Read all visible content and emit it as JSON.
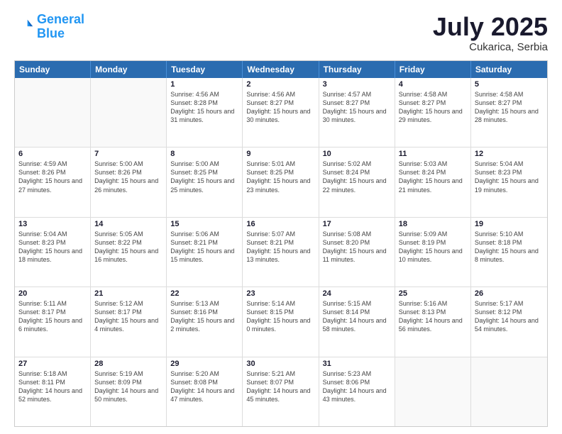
{
  "logo": {
    "line1": "General",
    "line2": "Blue"
  },
  "title": "July 2025",
  "subtitle": "Cukarica, Serbia",
  "header_days": [
    "Sunday",
    "Monday",
    "Tuesday",
    "Wednesday",
    "Thursday",
    "Friday",
    "Saturday"
  ],
  "weeks": [
    [
      {
        "day": "",
        "sunrise": "",
        "sunset": "",
        "daylight": ""
      },
      {
        "day": "",
        "sunrise": "",
        "sunset": "",
        "daylight": ""
      },
      {
        "day": "1",
        "sunrise": "Sunrise: 4:56 AM",
        "sunset": "Sunset: 8:28 PM",
        "daylight": "Daylight: 15 hours and 31 minutes."
      },
      {
        "day": "2",
        "sunrise": "Sunrise: 4:56 AM",
        "sunset": "Sunset: 8:27 PM",
        "daylight": "Daylight: 15 hours and 30 minutes."
      },
      {
        "day": "3",
        "sunrise": "Sunrise: 4:57 AM",
        "sunset": "Sunset: 8:27 PM",
        "daylight": "Daylight: 15 hours and 30 minutes."
      },
      {
        "day": "4",
        "sunrise": "Sunrise: 4:58 AM",
        "sunset": "Sunset: 8:27 PM",
        "daylight": "Daylight: 15 hours and 29 minutes."
      },
      {
        "day": "5",
        "sunrise": "Sunrise: 4:58 AM",
        "sunset": "Sunset: 8:27 PM",
        "daylight": "Daylight: 15 hours and 28 minutes."
      }
    ],
    [
      {
        "day": "6",
        "sunrise": "Sunrise: 4:59 AM",
        "sunset": "Sunset: 8:26 PM",
        "daylight": "Daylight: 15 hours and 27 minutes."
      },
      {
        "day": "7",
        "sunrise": "Sunrise: 5:00 AM",
        "sunset": "Sunset: 8:26 PM",
        "daylight": "Daylight: 15 hours and 26 minutes."
      },
      {
        "day": "8",
        "sunrise": "Sunrise: 5:00 AM",
        "sunset": "Sunset: 8:25 PM",
        "daylight": "Daylight: 15 hours and 25 minutes."
      },
      {
        "day": "9",
        "sunrise": "Sunrise: 5:01 AM",
        "sunset": "Sunset: 8:25 PM",
        "daylight": "Daylight: 15 hours and 23 minutes."
      },
      {
        "day": "10",
        "sunrise": "Sunrise: 5:02 AM",
        "sunset": "Sunset: 8:24 PM",
        "daylight": "Daylight: 15 hours and 22 minutes."
      },
      {
        "day": "11",
        "sunrise": "Sunrise: 5:03 AM",
        "sunset": "Sunset: 8:24 PM",
        "daylight": "Daylight: 15 hours and 21 minutes."
      },
      {
        "day": "12",
        "sunrise": "Sunrise: 5:04 AM",
        "sunset": "Sunset: 8:23 PM",
        "daylight": "Daylight: 15 hours and 19 minutes."
      }
    ],
    [
      {
        "day": "13",
        "sunrise": "Sunrise: 5:04 AM",
        "sunset": "Sunset: 8:23 PM",
        "daylight": "Daylight: 15 hours and 18 minutes."
      },
      {
        "day": "14",
        "sunrise": "Sunrise: 5:05 AM",
        "sunset": "Sunset: 8:22 PM",
        "daylight": "Daylight: 15 hours and 16 minutes."
      },
      {
        "day": "15",
        "sunrise": "Sunrise: 5:06 AM",
        "sunset": "Sunset: 8:21 PM",
        "daylight": "Daylight: 15 hours and 15 minutes."
      },
      {
        "day": "16",
        "sunrise": "Sunrise: 5:07 AM",
        "sunset": "Sunset: 8:21 PM",
        "daylight": "Daylight: 15 hours and 13 minutes."
      },
      {
        "day": "17",
        "sunrise": "Sunrise: 5:08 AM",
        "sunset": "Sunset: 8:20 PM",
        "daylight": "Daylight: 15 hours and 11 minutes."
      },
      {
        "day": "18",
        "sunrise": "Sunrise: 5:09 AM",
        "sunset": "Sunset: 8:19 PM",
        "daylight": "Daylight: 15 hours and 10 minutes."
      },
      {
        "day": "19",
        "sunrise": "Sunrise: 5:10 AM",
        "sunset": "Sunset: 8:18 PM",
        "daylight": "Daylight: 15 hours and 8 minutes."
      }
    ],
    [
      {
        "day": "20",
        "sunrise": "Sunrise: 5:11 AM",
        "sunset": "Sunset: 8:17 PM",
        "daylight": "Daylight: 15 hours and 6 minutes."
      },
      {
        "day": "21",
        "sunrise": "Sunrise: 5:12 AM",
        "sunset": "Sunset: 8:17 PM",
        "daylight": "Daylight: 15 hours and 4 minutes."
      },
      {
        "day": "22",
        "sunrise": "Sunrise: 5:13 AM",
        "sunset": "Sunset: 8:16 PM",
        "daylight": "Daylight: 15 hours and 2 minutes."
      },
      {
        "day": "23",
        "sunrise": "Sunrise: 5:14 AM",
        "sunset": "Sunset: 8:15 PM",
        "daylight": "Daylight: 15 hours and 0 minutes."
      },
      {
        "day": "24",
        "sunrise": "Sunrise: 5:15 AM",
        "sunset": "Sunset: 8:14 PM",
        "daylight": "Daylight: 14 hours and 58 minutes."
      },
      {
        "day": "25",
        "sunrise": "Sunrise: 5:16 AM",
        "sunset": "Sunset: 8:13 PM",
        "daylight": "Daylight: 14 hours and 56 minutes."
      },
      {
        "day": "26",
        "sunrise": "Sunrise: 5:17 AM",
        "sunset": "Sunset: 8:12 PM",
        "daylight": "Daylight: 14 hours and 54 minutes."
      }
    ],
    [
      {
        "day": "27",
        "sunrise": "Sunrise: 5:18 AM",
        "sunset": "Sunset: 8:11 PM",
        "daylight": "Daylight: 14 hours and 52 minutes."
      },
      {
        "day": "28",
        "sunrise": "Sunrise: 5:19 AM",
        "sunset": "Sunset: 8:09 PM",
        "daylight": "Daylight: 14 hours and 50 minutes."
      },
      {
        "day": "29",
        "sunrise": "Sunrise: 5:20 AM",
        "sunset": "Sunset: 8:08 PM",
        "daylight": "Daylight: 14 hours and 47 minutes."
      },
      {
        "day": "30",
        "sunrise": "Sunrise: 5:21 AM",
        "sunset": "Sunset: 8:07 PM",
        "daylight": "Daylight: 14 hours and 45 minutes."
      },
      {
        "day": "31",
        "sunrise": "Sunrise: 5:23 AM",
        "sunset": "Sunset: 8:06 PM",
        "daylight": "Daylight: 14 hours and 43 minutes."
      },
      {
        "day": "",
        "sunrise": "",
        "sunset": "",
        "daylight": ""
      },
      {
        "day": "",
        "sunrise": "",
        "sunset": "",
        "daylight": ""
      }
    ]
  ]
}
